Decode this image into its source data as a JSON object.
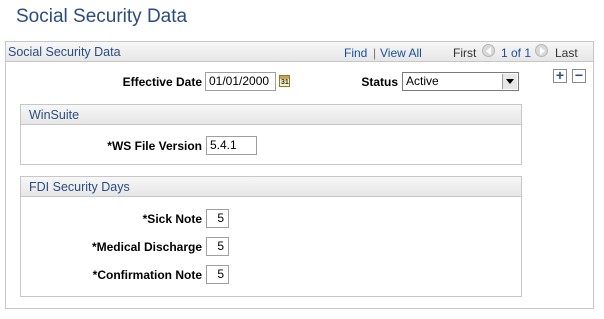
{
  "page": {
    "title": "Social Security Data"
  },
  "scroll_area": {
    "title": "Social Security Data",
    "nav": {
      "find_label": "Find",
      "separator": "|",
      "view_all_label": "View All",
      "first_label": "First",
      "range_text": "1 of 1",
      "last_label": "Last"
    },
    "add_row_symbol": "+",
    "delete_row_symbol": "−"
  },
  "effective_date": {
    "label": "Effective Date",
    "value": "01/01/2000",
    "calendar_icon_text": "31"
  },
  "status": {
    "label": "Status",
    "value": "Active"
  },
  "winsuite": {
    "title": "WinSuite",
    "ws_file_version": {
      "label": "*WS File Version",
      "value": "5.4.1"
    }
  },
  "fdi_security_days": {
    "title": "FDI Security Days",
    "sick_note": {
      "label": "*Sick Note",
      "value": "5"
    },
    "medical_discharge": {
      "label": "*Medical Discharge",
      "value": "5"
    },
    "confirmation_note": {
      "label": "*Confirmation Note",
      "value": "5"
    }
  },
  "colors": {
    "title_blue": "#2b4c80",
    "link_blue": "#1b4f9c",
    "border_gray": "#c7c7c7"
  }
}
